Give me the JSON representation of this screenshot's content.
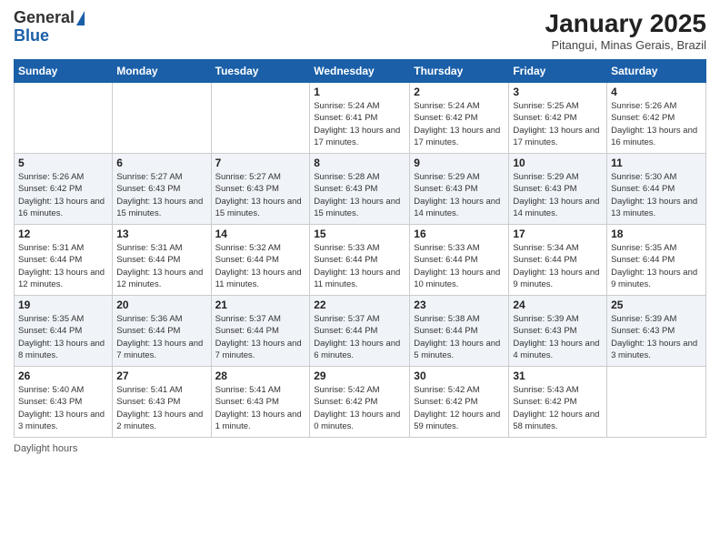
{
  "logo": {
    "general": "General",
    "blue": "Blue"
  },
  "header": {
    "title": "January 2025",
    "subtitle": "Pitangui, Minas Gerais, Brazil"
  },
  "days_of_week": [
    "Sunday",
    "Monday",
    "Tuesday",
    "Wednesday",
    "Thursday",
    "Friday",
    "Saturday"
  ],
  "weeks": [
    [
      {
        "day": "",
        "info": ""
      },
      {
        "day": "",
        "info": ""
      },
      {
        "day": "",
        "info": ""
      },
      {
        "day": "1",
        "info": "Sunrise: 5:24 AM\nSunset: 6:41 PM\nDaylight: 13 hours and 17 minutes."
      },
      {
        "day": "2",
        "info": "Sunrise: 5:24 AM\nSunset: 6:42 PM\nDaylight: 13 hours and 17 minutes."
      },
      {
        "day": "3",
        "info": "Sunrise: 5:25 AM\nSunset: 6:42 PM\nDaylight: 13 hours and 17 minutes."
      },
      {
        "day": "4",
        "info": "Sunrise: 5:26 AM\nSunset: 6:42 PM\nDaylight: 13 hours and 16 minutes."
      }
    ],
    [
      {
        "day": "5",
        "info": "Sunrise: 5:26 AM\nSunset: 6:42 PM\nDaylight: 13 hours and 16 minutes."
      },
      {
        "day": "6",
        "info": "Sunrise: 5:27 AM\nSunset: 6:43 PM\nDaylight: 13 hours and 15 minutes."
      },
      {
        "day": "7",
        "info": "Sunrise: 5:27 AM\nSunset: 6:43 PM\nDaylight: 13 hours and 15 minutes."
      },
      {
        "day": "8",
        "info": "Sunrise: 5:28 AM\nSunset: 6:43 PM\nDaylight: 13 hours and 15 minutes."
      },
      {
        "day": "9",
        "info": "Sunrise: 5:29 AM\nSunset: 6:43 PM\nDaylight: 13 hours and 14 minutes."
      },
      {
        "day": "10",
        "info": "Sunrise: 5:29 AM\nSunset: 6:43 PM\nDaylight: 13 hours and 14 minutes."
      },
      {
        "day": "11",
        "info": "Sunrise: 5:30 AM\nSunset: 6:44 PM\nDaylight: 13 hours and 13 minutes."
      }
    ],
    [
      {
        "day": "12",
        "info": "Sunrise: 5:31 AM\nSunset: 6:44 PM\nDaylight: 13 hours and 12 minutes."
      },
      {
        "day": "13",
        "info": "Sunrise: 5:31 AM\nSunset: 6:44 PM\nDaylight: 13 hours and 12 minutes."
      },
      {
        "day": "14",
        "info": "Sunrise: 5:32 AM\nSunset: 6:44 PM\nDaylight: 13 hours and 11 minutes."
      },
      {
        "day": "15",
        "info": "Sunrise: 5:33 AM\nSunset: 6:44 PM\nDaylight: 13 hours and 11 minutes."
      },
      {
        "day": "16",
        "info": "Sunrise: 5:33 AM\nSunset: 6:44 PM\nDaylight: 13 hours and 10 minutes."
      },
      {
        "day": "17",
        "info": "Sunrise: 5:34 AM\nSunset: 6:44 PM\nDaylight: 13 hours and 9 minutes."
      },
      {
        "day": "18",
        "info": "Sunrise: 5:35 AM\nSunset: 6:44 PM\nDaylight: 13 hours and 9 minutes."
      }
    ],
    [
      {
        "day": "19",
        "info": "Sunrise: 5:35 AM\nSunset: 6:44 PM\nDaylight: 13 hours and 8 minutes."
      },
      {
        "day": "20",
        "info": "Sunrise: 5:36 AM\nSunset: 6:44 PM\nDaylight: 13 hours and 7 minutes."
      },
      {
        "day": "21",
        "info": "Sunrise: 5:37 AM\nSunset: 6:44 PM\nDaylight: 13 hours and 7 minutes."
      },
      {
        "day": "22",
        "info": "Sunrise: 5:37 AM\nSunset: 6:44 PM\nDaylight: 13 hours and 6 minutes."
      },
      {
        "day": "23",
        "info": "Sunrise: 5:38 AM\nSunset: 6:44 PM\nDaylight: 13 hours and 5 minutes."
      },
      {
        "day": "24",
        "info": "Sunrise: 5:39 AM\nSunset: 6:43 PM\nDaylight: 13 hours and 4 minutes."
      },
      {
        "day": "25",
        "info": "Sunrise: 5:39 AM\nSunset: 6:43 PM\nDaylight: 13 hours and 3 minutes."
      }
    ],
    [
      {
        "day": "26",
        "info": "Sunrise: 5:40 AM\nSunset: 6:43 PM\nDaylight: 13 hours and 3 minutes."
      },
      {
        "day": "27",
        "info": "Sunrise: 5:41 AM\nSunset: 6:43 PM\nDaylight: 13 hours and 2 minutes."
      },
      {
        "day": "28",
        "info": "Sunrise: 5:41 AM\nSunset: 6:43 PM\nDaylight: 13 hours and 1 minute."
      },
      {
        "day": "29",
        "info": "Sunrise: 5:42 AM\nSunset: 6:42 PM\nDaylight: 13 hours and 0 minutes."
      },
      {
        "day": "30",
        "info": "Sunrise: 5:42 AM\nSunset: 6:42 PM\nDaylight: 12 hours and 59 minutes."
      },
      {
        "day": "31",
        "info": "Sunrise: 5:43 AM\nSunset: 6:42 PM\nDaylight: 12 hours and 58 minutes."
      },
      {
        "day": "",
        "info": ""
      }
    ]
  ],
  "footer": {
    "text": "Daylight hours"
  }
}
